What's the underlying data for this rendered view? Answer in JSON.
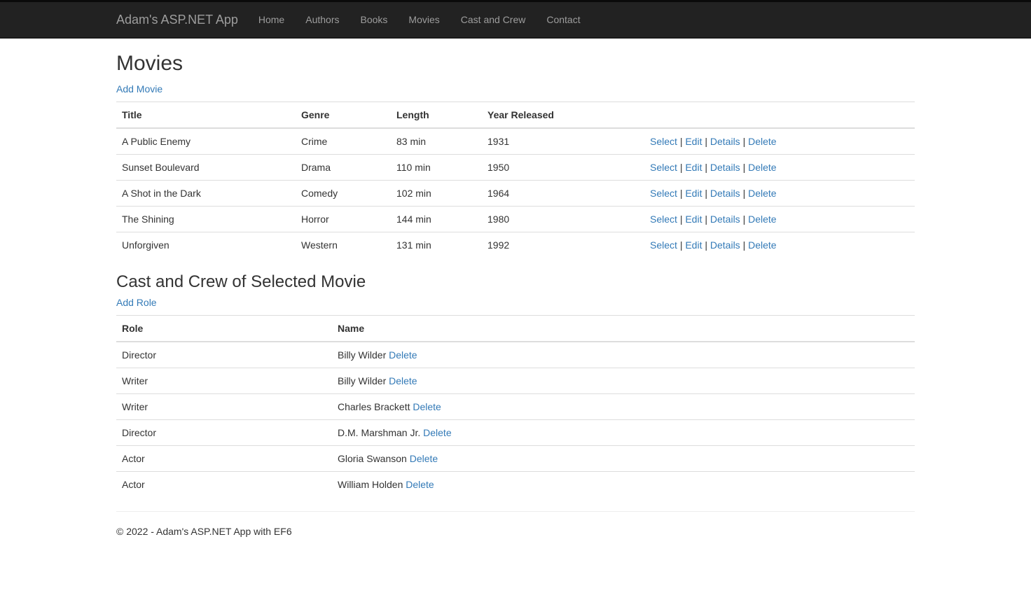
{
  "navbar": {
    "brand": "Adam's ASP.NET App",
    "links": [
      "Home",
      "Authors",
      "Books",
      "Movies",
      "Cast and Crew",
      "Contact"
    ]
  },
  "movies": {
    "title": "Movies",
    "add_label": "Add Movie",
    "headers": [
      "Title",
      "Genre",
      "Length",
      "Year Released"
    ],
    "actions": {
      "select": "Select",
      "edit": "Edit",
      "details": "Details",
      "delete": "Delete",
      "separator": "|"
    },
    "rows": [
      {
        "title": "A Public Enemy",
        "genre": "Crime",
        "length": "83 min",
        "year": "1931"
      },
      {
        "title": "Sunset Boulevard",
        "genre": "Drama",
        "length": "110 min",
        "year": "1950"
      },
      {
        "title": "A Shot in the Dark",
        "genre": "Comedy",
        "length": "102 min",
        "year": "1964"
      },
      {
        "title": "The Shining",
        "genre": "Horror",
        "length": "144 min",
        "year": "1980"
      },
      {
        "title": "Unforgiven",
        "genre": "Western",
        "length": "131 min",
        "year": "1992"
      }
    ]
  },
  "cast": {
    "title": "Cast and Crew of Selected Movie",
    "add_label": "Add Role",
    "headers": [
      "Role",
      "Name"
    ],
    "delete_label": "Delete",
    "rows": [
      {
        "role": "Director",
        "name": "Billy Wilder"
      },
      {
        "role": "Writer",
        "name": "Billy Wilder"
      },
      {
        "role": "Writer",
        "name": "Charles Brackett"
      },
      {
        "role": "Director",
        "name": "D.M. Marshman Jr."
      },
      {
        "role": "Actor",
        "name": "Gloria Swanson"
      },
      {
        "role": "Actor",
        "name": "William Holden"
      }
    ]
  },
  "footer": {
    "text": "© 2022 - Adam's ASP.NET App with EF6"
  },
  "colors": {
    "navbar": "#222222",
    "link": "#337ab7",
    "nav_text": "#9d9d9d"
  }
}
